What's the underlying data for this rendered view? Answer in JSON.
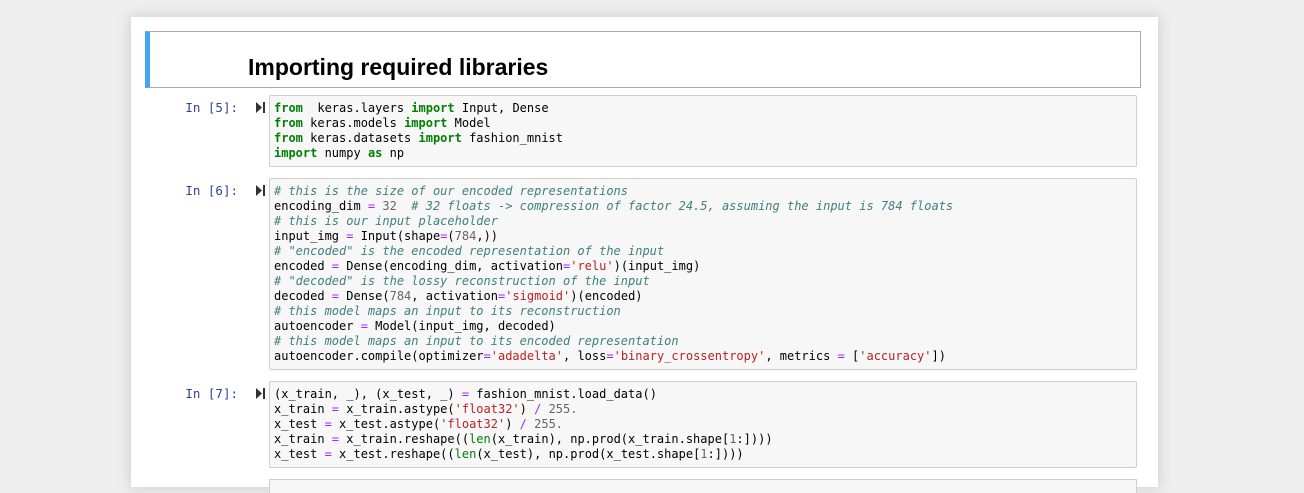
{
  "markdown": {
    "heading": "Importing required libraries"
  },
  "cells": [
    {
      "prompt": "In [5]:",
      "lines": [
        [
          [
            "kw",
            "from"
          ],
          [
            "",
            "  keras.layers "
          ],
          [
            "kw",
            "import"
          ],
          [
            "",
            " Input, Dense"
          ]
        ],
        [
          [
            "kw",
            "from"
          ],
          [
            "",
            " keras.models "
          ],
          [
            "kw",
            "import"
          ],
          [
            "",
            " Model"
          ]
        ],
        [
          [
            "kw",
            "from"
          ],
          [
            "",
            " keras.datasets "
          ],
          [
            "kw",
            "import"
          ],
          [
            "",
            " fashion_mnist"
          ]
        ],
        [
          [
            "kw",
            "import"
          ],
          [
            "",
            " numpy "
          ],
          [
            "kw",
            "as"
          ],
          [
            "",
            " np"
          ]
        ]
      ]
    },
    {
      "prompt": "In [6]:",
      "lines": [
        [
          [
            "cm",
            "# this is the size of our encoded representations"
          ]
        ],
        [
          [
            "",
            "encoding_dim "
          ],
          [
            "op",
            "="
          ],
          [
            " nu",
            " "
          ],
          [
            "nu",
            "32"
          ],
          [
            "",
            "  "
          ],
          [
            "cm",
            "# 32 floats -> compression of factor 24.5, assuming the input is 784 floats"
          ]
        ],
        [
          [
            "cm",
            "# this is our input placeholder"
          ]
        ],
        [
          [
            "",
            "input_img "
          ],
          [
            "op",
            "="
          ],
          [
            "",
            " Input(shape"
          ],
          [
            "op",
            "="
          ],
          [
            "",
            "("
          ],
          [
            "nu",
            "784"
          ],
          [
            "",
            ",))"
          ]
        ],
        [
          [
            "cm",
            "# \"encoded\" is the encoded representation of the input"
          ]
        ],
        [
          [
            "",
            "encoded "
          ],
          [
            "op",
            "="
          ],
          [
            "",
            " Dense(encoding_dim, activation"
          ],
          [
            "op",
            "="
          ],
          [
            "st",
            "'relu'"
          ],
          [
            "",
            ")(input_img)"
          ]
        ],
        [
          [
            "cm",
            "# \"decoded\" is the lossy reconstruction of the input"
          ]
        ],
        [
          [
            "",
            "decoded "
          ],
          [
            "op",
            "="
          ],
          [
            "",
            " Dense("
          ],
          [
            "nu",
            "784"
          ],
          [
            "",
            ", activation"
          ],
          [
            "op",
            "="
          ],
          [
            "st",
            "'sigmoid'"
          ],
          [
            "",
            ")(encoded)"
          ]
        ],
        [
          [
            "cm",
            "# this model maps an input to its reconstruction"
          ]
        ],
        [
          [
            "",
            "autoencoder "
          ],
          [
            "op",
            "="
          ],
          [
            "",
            " Model(input_img, decoded)"
          ]
        ],
        [
          [
            "cm",
            "# this model maps an input to its encoded representation"
          ]
        ],
        [
          [
            "",
            "autoencoder.compile(optimizer"
          ],
          [
            "op",
            "="
          ],
          [
            "st",
            "'adadelta'"
          ],
          [
            "",
            ", loss"
          ],
          [
            "op",
            "="
          ],
          [
            "st",
            "'binary_crossentropy'"
          ],
          [
            "",
            ", metrics "
          ],
          [
            "op",
            "="
          ],
          [
            "",
            " ["
          ],
          [
            "st",
            "'accuracy'"
          ],
          [
            "",
            "])"
          ]
        ]
      ]
    },
    {
      "prompt": "In [7]:",
      "lines": [
        [
          [
            "",
            "(x_train, _), (x_test, _) "
          ],
          [
            "op",
            "="
          ],
          [
            "",
            " fashion_mnist.load_data()"
          ]
        ],
        [
          [
            "",
            "x_train "
          ],
          [
            "op",
            "="
          ],
          [
            "",
            " x_train.astype("
          ],
          [
            "st",
            "'float32'"
          ],
          [
            "",
            ") "
          ],
          [
            "op",
            "/"
          ],
          [
            "",
            ""
          ],
          [
            "nu",
            " 255."
          ]
        ],
        [
          [
            "",
            "x_test "
          ],
          [
            "op",
            "="
          ],
          [
            "",
            " x_test.astype("
          ],
          [
            "st",
            "'float32'"
          ],
          [
            "",
            ") "
          ],
          [
            "op",
            "/"
          ],
          [
            "nu",
            " 255."
          ]
        ],
        [
          [
            "",
            "x_train "
          ],
          [
            "op",
            "="
          ],
          [
            "",
            " x_train.reshape(("
          ],
          [
            "bi",
            "len"
          ],
          [
            "",
            "(x_train), np.prod(x_train.shape["
          ],
          [
            "nu",
            "1"
          ],
          [
            "",
            ":])))"
          ]
        ],
        [
          [
            "",
            "x_test "
          ],
          [
            "op",
            "="
          ],
          [
            "",
            " x_test.reshape(("
          ],
          [
            "bi",
            "len"
          ],
          [
            "",
            "(x_test), np.prod(x_test.shape["
          ],
          [
            "nu",
            "1"
          ],
          [
            "",
            ":])))"
          ]
        ]
      ]
    }
  ]
}
